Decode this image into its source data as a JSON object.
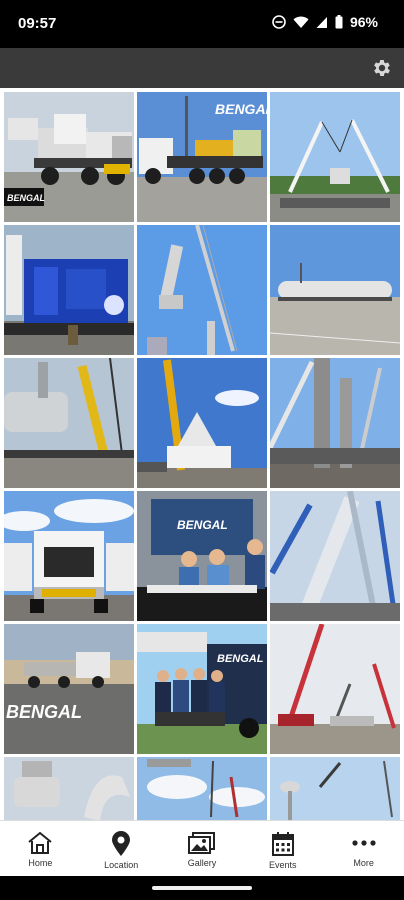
{
  "status_bar": {
    "time": "09:57",
    "battery": "96%",
    "icons": [
      "do-not-disturb-icon",
      "wifi-icon",
      "signal-icon",
      "battery-icon"
    ]
  },
  "app_bar": {
    "settings_icon": "gear-icon"
  },
  "gallery": {
    "photos": [
      {
        "subject": "heavy-haul truck with load",
        "caption": "BENGAL"
      },
      {
        "subject": "white truck with yellow machinery",
        "caption": "BENGAL"
      },
      {
        "subject": "two cranes lifting at site",
        "caption": ""
      },
      {
        "subject": "blue industrial equipment",
        "caption": ""
      },
      {
        "subject": "vertical vessel being lifted",
        "caption": ""
      },
      {
        "subject": "long white vessel on trailer",
        "caption": ""
      },
      {
        "subject": "vessel and yellow lattice crane",
        "caption": ""
      },
      {
        "subject": "yellow crane and white tank",
        "caption": ""
      },
      {
        "subject": "large lattice cranes at refinery",
        "caption": ""
      },
      {
        "subject": "front of white semi truck",
        "caption": ""
      },
      {
        "subject": "trade show booth team",
        "caption": "BENGAL"
      },
      {
        "subject": "cranes raising white vessel",
        "caption": ""
      },
      {
        "subject": "truck convoy at sunset",
        "caption": "BENGAL"
      },
      {
        "subject": "team group photo",
        "caption": "BENGAL"
      },
      {
        "subject": "red crawler cranes",
        "caption": ""
      },
      {
        "subject": "white vessel partial",
        "caption": ""
      },
      {
        "subject": "clouds and cranes partial",
        "caption": ""
      },
      {
        "subject": "water tower partial",
        "caption": ""
      }
    ]
  },
  "bottom_nav": {
    "items": [
      {
        "label": "Home",
        "icon": "home-icon"
      },
      {
        "label": "Location",
        "icon": "location-pin-icon"
      },
      {
        "label": "Gallery",
        "icon": "gallery-icon"
      },
      {
        "label": "Events",
        "icon": "calendar-icon"
      },
      {
        "label": "More",
        "icon": "more-dots-icon"
      }
    ]
  }
}
